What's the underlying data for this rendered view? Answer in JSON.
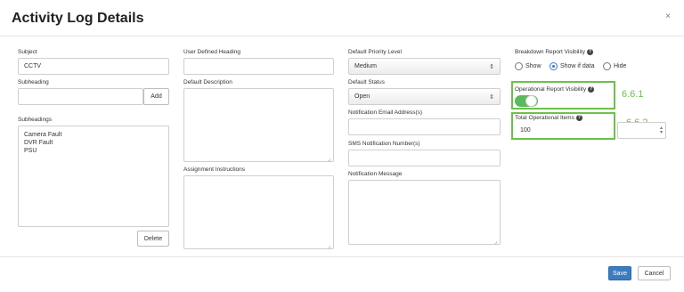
{
  "modal": {
    "title": "Activity Log Details",
    "close_label": "×"
  },
  "col1": {
    "subject_label": "Subject",
    "subject_value": "CCTV",
    "subheading_label": "Subheading",
    "subheading_value": "",
    "add_label": "Add",
    "subheadings_label": "Subheadings",
    "subheadings": [
      "Camera Fault",
      "DVR Fault",
      "PSU"
    ],
    "delete_label": "Delete"
  },
  "col2": {
    "user_heading_label": "User Defined Heading",
    "user_heading_value": "",
    "default_description_label": "Default Description",
    "assignment_label": "Assignment Instructions"
  },
  "col3": {
    "priority_label": "Default Priority Level",
    "priority_value": "Medium",
    "status_label": "Default Status",
    "status_value": "Open",
    "email_label": "Notification Email Address(s)",
    "sms_label": "SMS Notification Number(s)",
    "message_label": "Notification Message"
  },
  "col4": {
    "breakdown_label": "Breakdown Report Visibility",
    "breakdown_options": [
      "Show",
      "Show if data",
      "Hide"
    ],
    "breakdown_selected": "Show if data",
    "operational_label": "Operational Report Visibility",
    "operational_on": true,
    "total_label": "Total Operational Items",
    "total_value": "100",
    "annotation_1": "6.6.1",
    "annotation_2": "6.6.2",
    "help_glyph": "?"
  },
  "footer": {
    "save_label": "Save",
    "cancel_label": "Cancel"
  },
  "colors": {
    "accent_green": "#6cc04a",
    "primary_blue": "#3a7cc0",
    "toggle_green": "#5cb85c"
  }
}
